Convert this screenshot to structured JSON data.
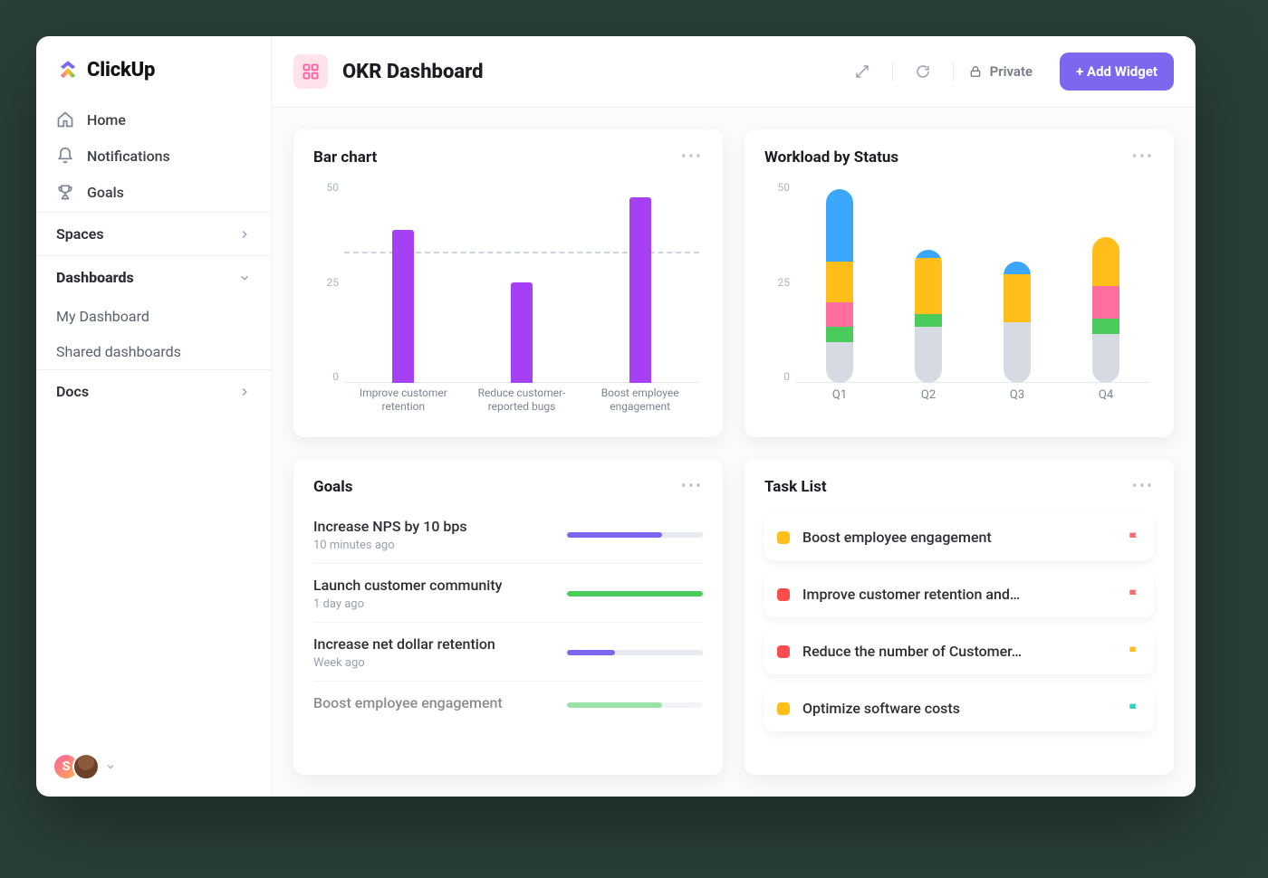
{
  "brand": {
    "name": "ClickUp"
  },
  "sidebar": {
    "items": [
      {
        "label": "Home",
        "icon": "home-icon"
      },
      {
        "label": "Notifications",
        "icon": "bell-icon"
      },
      {
        "label": "Goals",
        "icon": "trophy-icon"
      }
    ],
    "sections": {
      "spaces": {
        "label": "Spaces",
        "expanded": false
      },
      "dashboards": {
        "label": "Dashboards",
        "expanded": true,
        "children": [
          {
            "label": "My Dashboard"
          },
          {
            "label": "Shared dashboards"
          }
        ]
      },
      "docs": {
        "label": "Docs",
        "expanded": false
      }
    },
    "footer": {
      "avatar_initial": "S"
    }
  },
  "header": {
    "title": "OKR Dashboard",
    "privacy_label": "Private",
    "add_widget_label": "+ Add Widget"
  },
  "widgets": {
    "bar_chart": {
      "title": "Bar chart"
    },
    "workload": {
      "title": "Workload by Status"
    },
    "goals": {
      "title": "Goals",
      "items": [
        {
          "title": "Increase NPS by 10 bps",
          "time": "10 minutes ago",
          "progress": 70,
          "color": "#7b68ee"
        },
        {
          "title": "Launch customer community",
          "time": "1 day ago",
          "progress": 100,
          "color": "#49cc5c"
        },
        {
          "title": "Increase net dollar retention",
          "time": "Week ago",
          "progress": 35,
          "color": "#7b68ee"
        },
        {
          "title": "Boost employee engagement",
          "time": "",
          "progress": 70,
          "color": "#49cc5c"
        }
      ]
    },
    "task_list": {
      "title": "Task List",
      "items": [
        {
          "title": "Boost employee engagement",
          "status_color": "#ffbe1a",
          "flag_color": "#fd6b6b"
        },
        {
          "title": "Improve customer retention and…",
          "status_color": "#ff4d4d",
          "flag_color": "#fd6b6b"
        },
        {
          "title": "Reduce the number of Customer…",
          "status_color": "#ff4d4d",
          "flag_color": "#ffbe1a"
        },
        {
          "title": "Optimize software costs",
          "status_color": "#ffbe1a",
          "flag_color": "#29d3c0"
        }
      ]
    }
  },
  "chart_data": [
    {
      "id": "bar_chart",
      "type": "bar",
      "title": "Bar chart",
      "categories": [
        "Improve customer retention",
        "Reduce customer-reported bugs",
        "Boost employee engagement"
      ],
      "values": [
        38,
        25,
        46
      ],
      "ylim": [
        0,
        50
      ],
      "y_ticks": [
        0,
        25,
        50
      ],
      "reference_line": 32,
      "bar_color": "#a540f4"
    },
    {
      "id": "workload_by_status",
      "type": "bar_stacked",
      "title": "Workload by Status",
      "categories": [
        "Q1",
        "Q2",
        "Q3",
        "Q4"
      ],
      "series": [
        {
          "name": "grey",
          "color": "#d6dae2",
          "values": [
            10,
            14,
            15,
            12
          ]
        },
        {
          "name": "green",
          "color": "#49cc5c",
          "values": [
            4,
            3,
            0,
            4
          ]
        },
        {
          "name": "pink",
          "color": "#ff6e9c",
          "values": [
            6,
            0,
            0,
            8
          ]
        },
        {
          "name": "yellow",
          "color": "#ffbe1a",
          "values": [
            10,
            14,
            12,
            12
          ]
        },
        {
          "name": "blue",
          "color": "#3ba7ff",
          "values": [
            18,
            2,
            3,
            0
          ]
        }
      ],
      "ylim": [
        0,
        50
      ],
      "y_ticks": [
        0,
        25,
        50
      ]
    }
  ]
}
